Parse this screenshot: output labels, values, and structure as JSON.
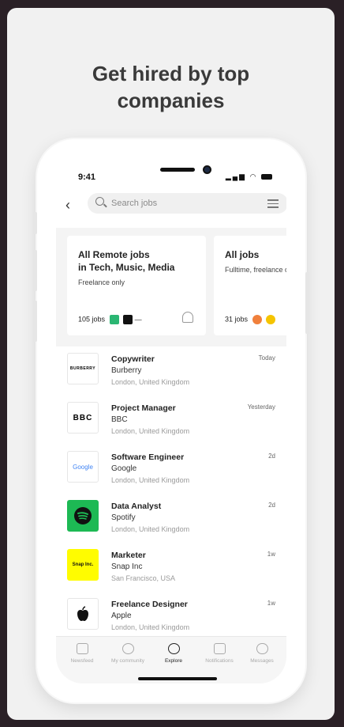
{
  "headline": {
    "line1": "Get hired by top",
    "line2": "companies"
  },
  "status_bar": {
    "time": "9:41"
  },
  "search": {
    "placeholder": "Search jobs"
  },
  "featured_cards": [
    {
      "title_line1": "All Remote jobs",
      "title_line2": "in Tech, Music, Media",
      "subtitle": "Freelance only",
      "count": "105 jobs"
    },
    {
      "title_line1": "All jobs",
      "title_line2": "",
      "subtitle": "Fulltime, freelance or",
      "count": "31 jobs"
    }
  ],
  "jobs": [
    {
      "title": "Copywriter",
      "company": "Burberry",
      "location": "London, United Kingdom",
      "when": "Today",
      "logo_text": "BURBERRY"
    },
    {
      "title": "Project Manager",
      "company": "BBC",
      "location": "London, United Kingdom",
      "when": "Yesterday",
      "logo_text": "BBC"
    },
    {
      "title": "Software Engineer",
      "company": "Google",
      "location": "London, United Kingdom",
      "when": "2d",
      "logo_text": "Google"
    },
    {
      "title": "Data Analyst",
      "company": "Spotify",
      "location": "London, United Kingdom",
      "when": "2d",
      "logo_text": ""
    },
    {
      "title": "Marketer",
      "company": "Snap Inc",
      "location": "San Francisco, USA",
      "when": "1w",
      "logo_text": "Snap Inc."
    },
    {
      "title": "Freelance Designer",
      "company": "Apple",
      "location": "London, United Kingdom",
      "when": "1w",
      "logo_text": ""
    }
  ],
  "tabs": [
    {
      "label": "Newsfeed",
      "icon": "home-icon"
    },
    {
      "label": "My community",
      "icon": "community-icon"
    },
    {
      "label": "Explore",
      "icon": "search-icon"
    },
    {
      "label": "Notifications",
      "icon": "notification-icon"
    },
    {
      "label": "Messages",
      "icon": "messages-icon"
    }
  ],
  "colors": {
    "spotify": "#1db954",
    "snap": "#fffc00",
    "background": "#2a2026"
  }
}
